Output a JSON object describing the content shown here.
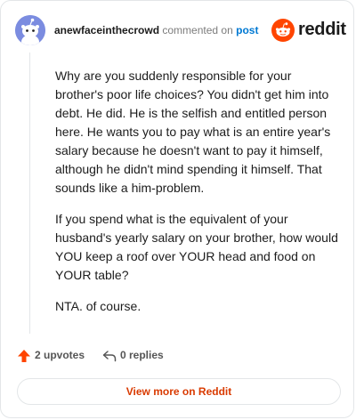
{
  "header": {
    "username": "anewfaceinthecrowd",
    "action_text": "commented on",
    "post_link": "post",
    "brand_wordmark": "reddit"
  },
  "comment": {
    "paragraphs": [
      "Why are you suddenly responsible for your brother's poor life choices? You didn't get him into debt. He did. He is the selfish and entitled person here. He wants you to pay what is an entire year's salary because he doesn't want to pay it himself, although he didn't mind spending it himself. That sounds like a him-problem.",
      "If you spend what is the equivalent of your husband's yearly salary on your brother, how would YOU keep a roof over YOUR head and food on YOUR table?",
      "NTA. of course."
    ]
  },
  "actions": {
    "upvotes_label": "2 upvotes",
    "replies_label": "0 replies"
  },
  "footer": {
    "view_more_label": "View more on Reddit"
  },
  "colors": {
    "brand": "#ff4500",
    "upvote": "#ff4500",
    "link": "#0079d3",
    "view_more_text": "#d93a00",
    "avatar_bg": "#7b8ce0"
  },
  "icons": {
    "avatar": "snoo-avatar-icon",
    "logo": "reddit-logo-icon",
    "upvote": "upvote-arrow-icon",
    "reply": "reply-arrow-icon"
  }
}
